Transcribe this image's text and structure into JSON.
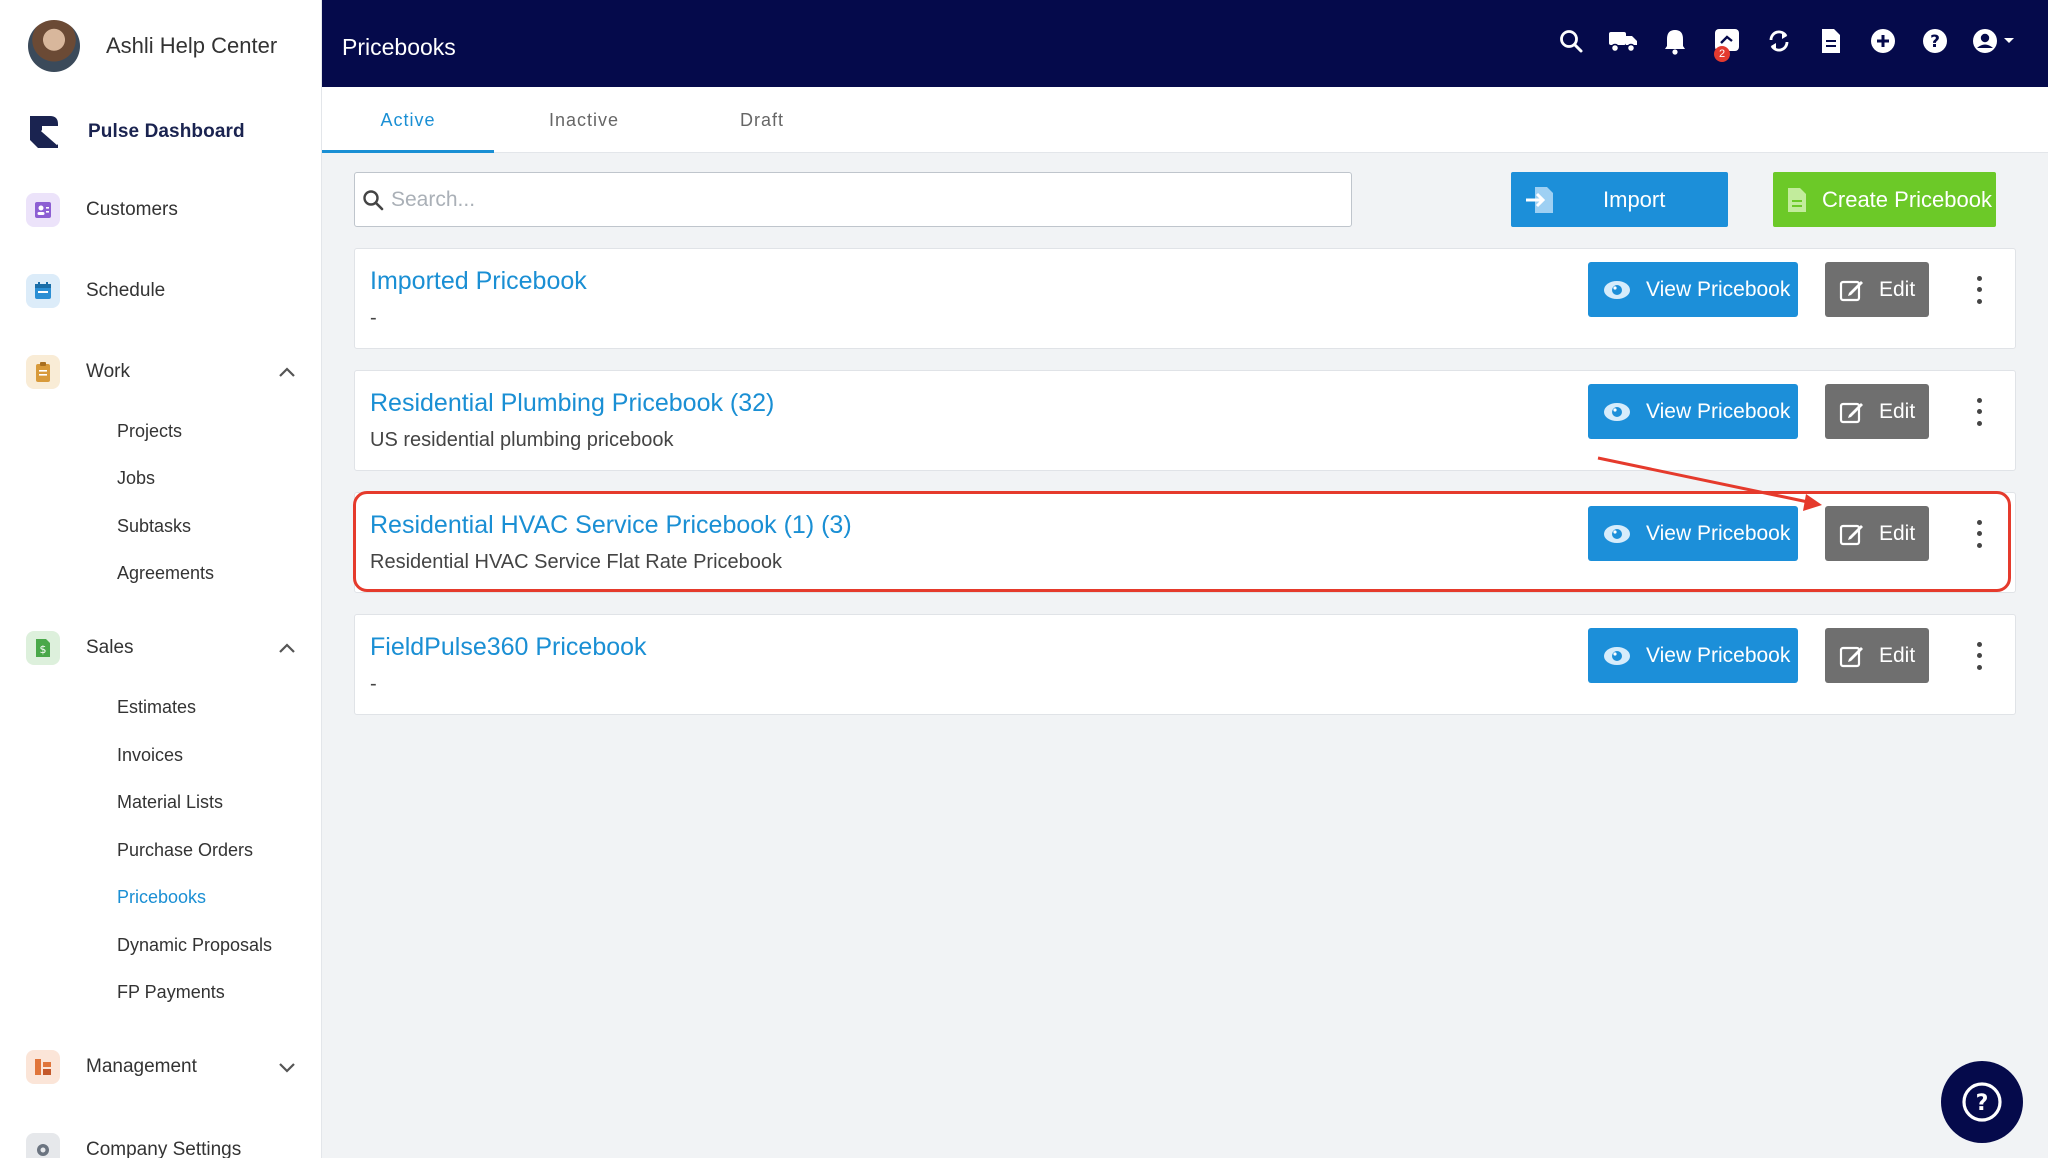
{
  "sidebar": {
    "profile_name": "Ashli Help Center",
    "pulse_label": "Pulse Dashboard",
    "items": [
      {
        "label": "Customers",
        "icon": "customers-icon",
        "color": "#8d5fd3"
      },
      {
        "label": "Schedule",
        "icon": "calendar-icon",
        "color": "#2b8fd4"
      },
      {
        "label": "Work",
        "icon": "clipboard-icon",
        "color": "#d89a3a",
        "expanded": true
      },
      {
        "label": "Sales",
        "icon": "dollar-document-icon",
        "color": "#4aa84a",
        "expanded": true
      },
      {
        "label": "Management",
        "icon": "management-icon",
        "color": "#e0753a",
        "expanded": false
      },
      {
        "label": "Company Settings",
        "icon": "gear-icon",
        "color": "#6b7480"
      }
    ],
    "work_sub": [
      "Projects",
      "Jobs",
      "Subtasks",
      "Agreements"
    ],
    "sales_sub": [
      "Estimates",
      "Invoices",
      "Material Lists",
      "Purchase Orders",
      "Pricebooks",
      "Dynamic Proposals",
      "FP Payments"
    ],
    "active_sub": "Pricebooks"
  },
  "header": {
    "title": "Pricebooks",
    "icons": [
      "search-icon",
      "truck-icon",
      "bell-icon",
      "chat-icon",
      "sync-icon",
      "document-icon",
      "add-circle-icon",
      "help-circle-icon",
      "account-icon"
    ],
    "chat_badge": "2"
  },
  "tabs": [
    {
      "label": "Active",
      "active": true
    },
    {
      "label": "Inactive",
      "active": false
    },
    {
      "label": "Draft",
      "active": false
    }
  ],
  "toolbar": {
    "search_placeholder": "Search...",
    "import_label": "Import",
    "create_label": "Create Pricebook"
  },
  "pricebooks": [
    {
      "title": "Imported Pricebook",
      "description": "-"
    },
    {
      "title": "Residential Plumbing Pricebook (32)",
      "description": "US residential plumbing pricebook"
    },
    {
      "title": "Residential HVAC Service Pricebook (1) (3)",
      "description": "Residential HVAC Service Flat Rate Pricebook",
      "highlighted": true
    },
    {
      "title": "FieldPulse360 Pricebook",
      "description": "-"
    }
  ],
  "card_actions": {
    "view_label": "View Pricebook",
    "edit_label": "Edit"
  },
  "colors": {
    "header_bg": "#050a4b",
    "primary": "#1c8fd9",
    "create": "#6cc928",
    "edit": "#6f6f6f",
    "highlight": "#e53a2c"
  }
}
